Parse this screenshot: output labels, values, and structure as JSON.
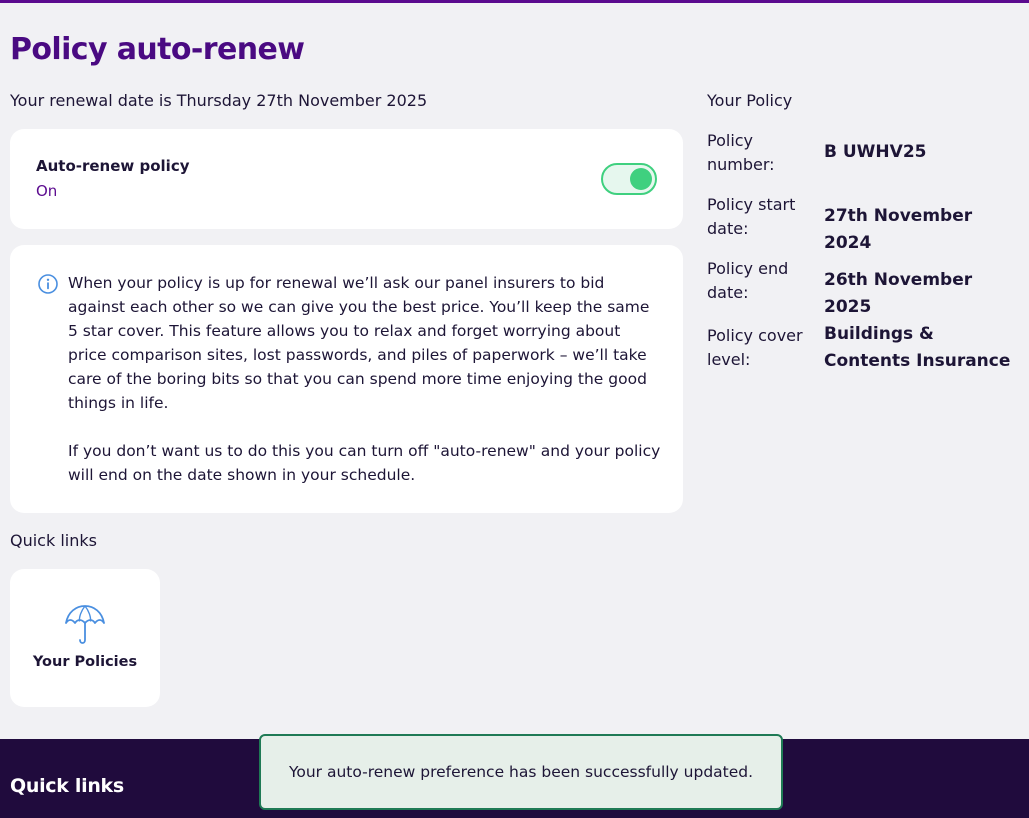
{
  "page": {
    "title": "Policy auto-renew",
    "renewal_text": "Your renewal date is Thursday 27th November 2025"
  },
  "auto_renew": {
    "title": "Auto-renew policy",
    "state": "On",
    "enabled": true,
    "accent_color": "#3fd07f"
  },
  "info": {
    "icon": "info-icon",
    "paragraph_1": "When your policy is up for renewal we’ll ask our panel insurers to bid against each other so we can give you the best price. You’ll keep the same 5 star cover. This feature allows you to relax and forget worrying about price comparison sites, lost passwords, and piles of paperwork – we’ll take care of the boring bits so that you can spend more time enjoying the good things in life.",
    "paragraph_2": "If you don’t want us to do this you can turn off \"auto-renew\" and your policy will end on the date shown in your schedule."
  },
  "quick_links": {
    "label": "Quick links",
    "tiles": [
      {
        "label": "Your Policies",
        "icon": "umbrella-icon"
      }
    ]
  },
  "policy_summary": {
    "heading": "Your Policy",
    "rows": [
      {
        "label": "Policy number:",
        "value": "B UWHV25"
      },
      {
        "label": "Policy start date:",
        "value": "27th November 2024"
      },
      {
        "label": "Policy end date:",
        "value": "26th November 2025"
      },
      {
        "label": "Policy cover level:",
        "value": "Buildings & Contents Insurance"
      }
    ]
  },
  "footer": {
    "title": "Quick links"
  },
  "toast": {
    "message": "Your auto-renew preference has been successfully updated."
  },
  "colors": {
    "brand_purple": "#4a0a82",
    "footer_bg": "#200b3d",
    "toast_border": "#1f7a55",
    "toggle_on": "#3fd07f"
  }
}
